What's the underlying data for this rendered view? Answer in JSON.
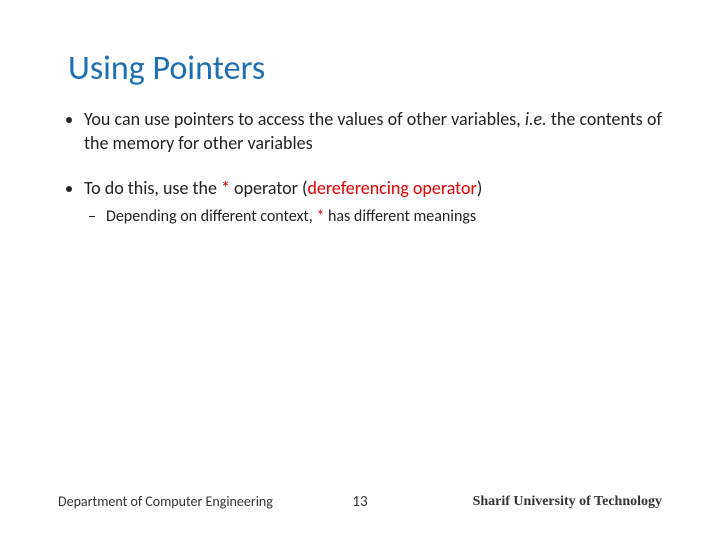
{
  "title": "Using Pointers",
  "bullets": {
    "b1_part1": "You can use pointers to access the values of other variables, ",
    "b1_ie": "i.e.",
    "b1_part2": " the contents of the memory for other variables",
    "b2_part1": "To do this, use the ",
    "b2_star": "*",
    "b2_part2": " operator (",
    "b2_deref": "dereferencing operator",
    "b2_part3": ")",
    "b2_sub_part1": "Depending on different context, ",
    "b2_sub_star": "*",
    "b2_sub_part2": " has different meanings"
  },
  "footer": {
    "left": "Department of Computer Engineering",
    "page": "13",
    "right": "Sharif University of Technology"
  }
}
